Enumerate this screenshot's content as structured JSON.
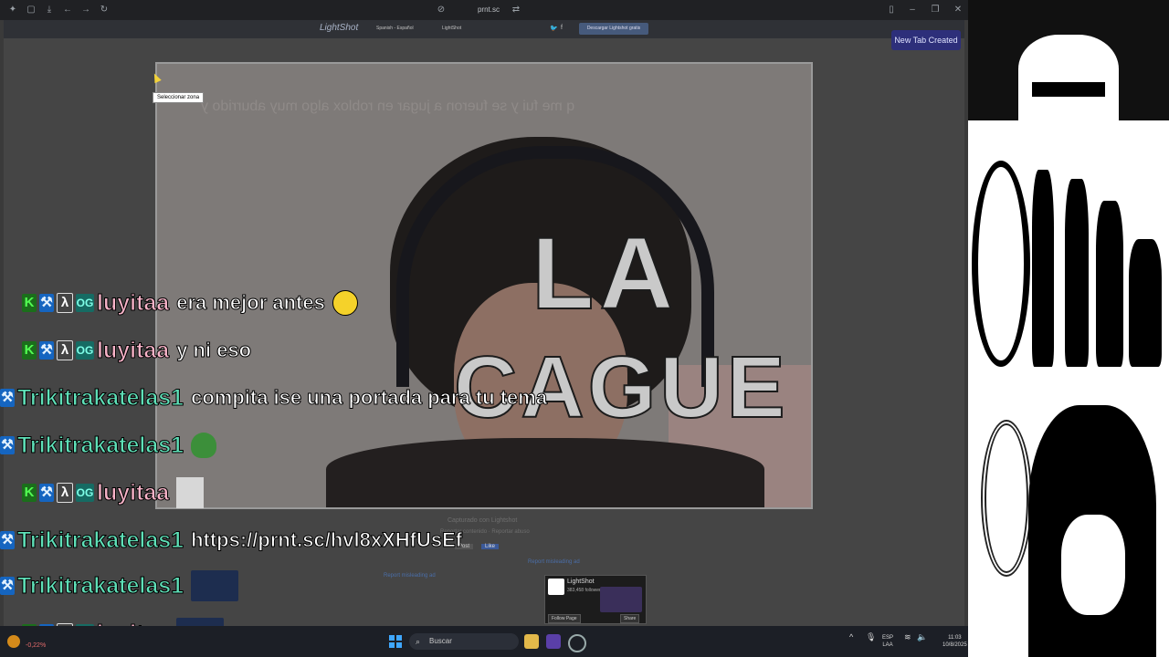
{
  "browser": {
    "url": "prnt.sc",
    "new_tab_toast": "New Tab Created"
  },
  "lightshot": {
    "logo": "LightShot",
    "language": "Spanish - Español",
    "nav_link": "LightShot",
    "download_button": "Descargar Lightshot gratis",
    "tooltip": "Seleccionar zona",
    "captured_with": "Capturado con Lightshot",
    "report_links": "Reportar contenido · Reportar abuso",
    "share_post": "Post",
    "share_like": "Like",
    "report_left": "Report misleading ad",
    "report_right": "Report misleading ad",
    "fb_card": {
      "title": "LightShot",
      "followers": "383,458 followers",
      "follow": "Follow Page",
      "share": "Share"
    }
  },
  "screenshot": {
    "mirrored_caption": "q me fui y se fueron a jugar en roblox algo muy aburrido y",
    "overlay_line1": "LA",
    "overlay_line2": "CAGUE"
  },
  "chat": [
    {
      "user": "luyitaa",
      "badges": [
        "K",
        "B",
        "O",
        "G"
      ],
      "message": "era mejor antes",
      "emote": "smile-emote"
    },
    {
      "user": "luyitaa",
      "badges": [
        "K",
        "B",
        "O",
        "G"
      ],
      "message": "y ni eso",
      "emote": ""
    },
    {
      "user": "Trikitrakatelas1",
      "badges": [
        "B"
      ],
      "message": "compita ise una portada para tu tema",
      "emote": ""
    },
    {
      "user": "Trikitrakatelas1",
      "badges": [
        "B"
      ],
      "message": "",
      "emote": "frog-emote"
    },
    {
      "user": "luyitaa",
      "badges": [
        "K",
        "B",
        "O",
        "G"
      ],
      "message": "",
      "emote": "bag-emote"
    },
    {
      "user": "Trikitrakatelas1",
      "badges": [
        "B"
      ],
      "message": "https://prnt.sc/hvl8xXHfUsEf",
      "emote": ""
    },
    {
      "user": "Trikitrakatelas1",
      "badges": [
        "B"
      ],
      "message": "",
      "emote": "minion-emote"
    },
    {
      "user": "luyitaa",
      "badges": [
        "K",
        "B",
        "O",
        "G"
      ],
      "message": "",
      "emote": "minion-emote"
    }
  ],
  "taskbar": {
    "search_placeholder": "Buscar",
    "lang_top": "ESP",
    "lang_bottom": "LAA",
    "time": "11:03",
    "date": "10/8/2025",
    "stock": "-0,22%"
  },
  "colors": {
    "user_luyitaa": "#f8b3c8",
    "user_trikitrakatelas": "#5fe0b8",
    "toast": "#2d2f7a"
  }
}
